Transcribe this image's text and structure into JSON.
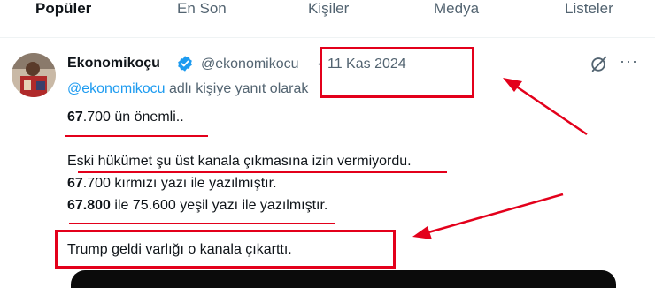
{
  "tabs": [
    {
      "label": "Popüler"
    },
    {
      "label": "En Son"
    },
    {
      "label": "Kişiler"
    },
    {
      "label": "Medya"
    },
    {
      "label": "Listeler"
    }
  ],
  "tweet": {
    "author_name": "Ekonomikoçu",
    "handle": "@ekonomikocu",
    "separator": "·",
    "date": "11 Kas 2024",
    "reply_mention": "@ekonomikocu",
    "reply_suffix": " adlı kişiye yanıt olarak",
    "lines": [
      {
        "bold": "67",
        "rest": ".700 ün önemli.."
      },
      {
        "bold": "",
        "rest": "Eski hükümet şu üst kanala çıkmasına izin vermiyordu."
      },
      {
        "bold": "67",
        "rest": ".700 kırmızı yazı ile yazılmıştır."
      },
      {
        "bold": "67.800",
        "rest": " ile 75.600 yeşil yazı ile yazılmıştır."
      },
      {
        "bold": "",
        "rest": "Trump geldi varlığı o kanala çıkarttı."
      }
    ],
    "more_label": "···"
  },
  "colors": {
    "annotation_red": "#e3001b",
    "link_blue": "#1d9bf0",
    "verified_blue": "#1d9bf0",
    "secondary_text": "#536471"
  },
  "icons": [
    "verified-badge-icon",
    "grok-icon",
    "more-icon"
  ]
}
